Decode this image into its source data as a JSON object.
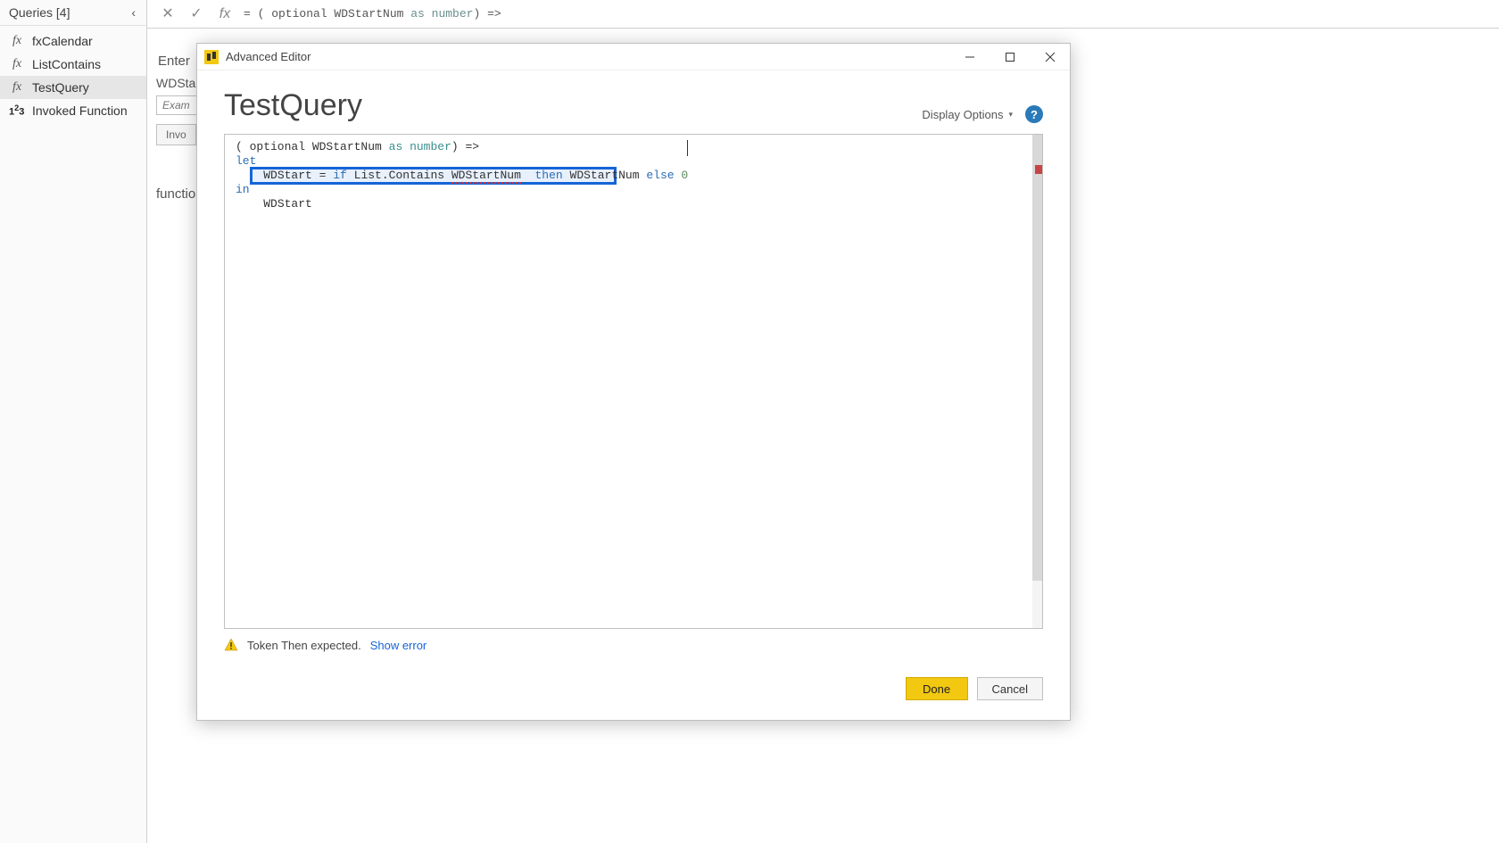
{
  "queries_panel": {
    "title": "Queries [4]",
    "items": [
      {
        "icon": "fx",
        "label": "fxCalendar"
      },
      {
        "icon": "fx",
        "label": "ListContains"
      },
      {
        "icon": "fx",
        "label": "TestQuery",
        "selected": true
      },
      {
        "icon": "123",
        "label": "Invoked Function"
      }
    ]
  },
  "formula_bar": {
    "prefix": "= ( optional WDStartNum ",
    "kw_as": "as",
    "kw_number": "number",
    "suffix": ") =>"
  },
  "background": {
    "enter_label": "Enter",
    "field_label": "WDSta",
    "example_placeholder": "Exam",
    "invoke_label": "Invo",
    "function_label": "function"
  },
  "modal": {
    "title": "Advanced Editor",
    "heading": "TestQuery",
    "display_options": "Display Options",
    "code": {
      "line1_a": "( optional WDStartNum ",
      "line1_as": "as",
      "line1_sp": " ",
      "line1_number": "number",
      "line1_b": ") =>",
      "line2": "let",
      "line3_ind": "    ",
      "line3_a": "WDStart = ",
      "line3_if": "if",
      "line3_b": " List.Contains ",
      "line3_err": "WDStartNum",
      "line3_sp2": "  ",
      "line3_then": "then",
      "line3_c": " WDStartNum ",
      "line3_else": "else",
      "line3_sp3": " ",
      "line3_zero": "0",
      "line4": "in",
      "line5_ind": "    ",
      "line5": "WDStart"
    },
    "error_text": "Token Then expected.",
    "show_error": "Show error",
    "done": "Done",
    "cancel": "Cancel"
  }
}
